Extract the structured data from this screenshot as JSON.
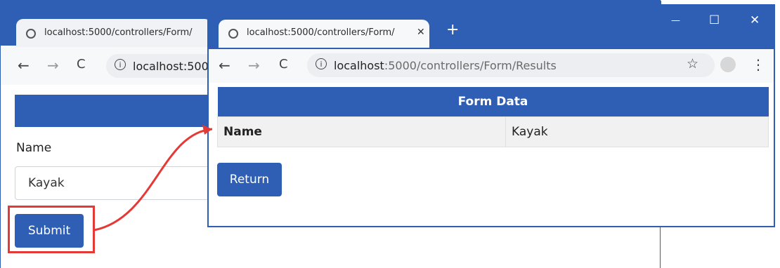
{
  "back_window": {
    "tab_title": "localhost:5000/controllers/Form/",
    "address": "localhost:500",
    "name_label": "Name",
    "name_value": "Kayak",
    "submit_label": "Submit"
  },
  "front_window": {
    "tab_title": "localhost:5000/controllers/Form/",
    "tab_close": "✕",
    "new_tab": "+",
    "address_host": "localhost",
    "address_path": ":5000/controllers/Form/Results",
    "table_header": "Form Data",
    "rows": [
      {
        "key": "Name",
        "value": "Kayak"
      }
    ],
    "return_label": "Return"
  },
  "icons": {
    "back": "←",
    "forward": "→",
    "reload": "C",
    "info": "i",
    "star": "☆",
    "menu": "⋮",
    "minimize": "—",
    "maximize": "☐",
    "close": "✕"
  },
  "colors": {
    "accent": "#2f5fb4",
    "highlight": "#e53935"
  }
}
